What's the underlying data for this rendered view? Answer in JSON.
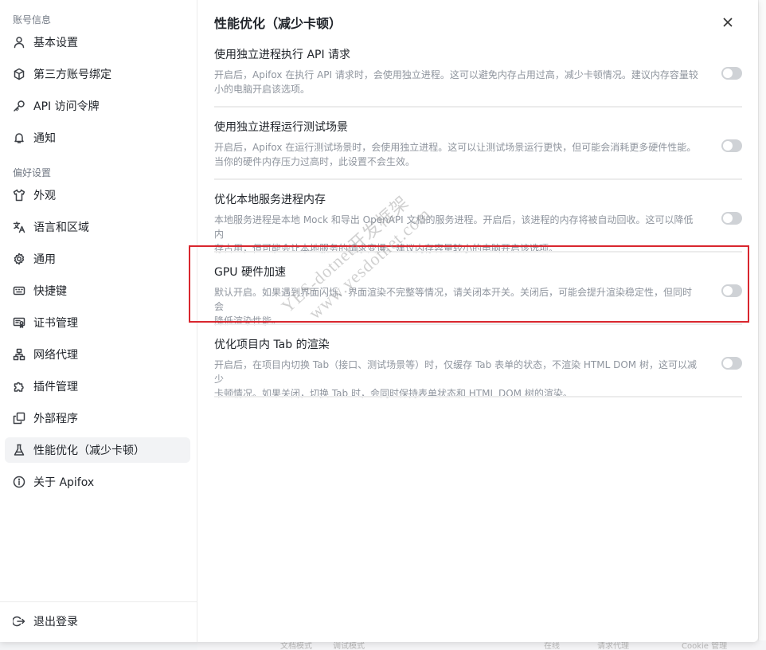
{
  "sidebar": {
    "group1_title": "账号信息",
    "group2_title": "偏好设置",
    "items": [
      {
        "label": "基本设置",
        "icon": "user-icon"
      },
      {
        "label": "第三方账号绑定",
        "icon": "cube-icon"
      },
      {
        "label": "API 访问令牌",
        "icon": "key-icon"
      },
      {
        "label": "通知",
        "icon": "bell-icon"
      },
      {
        "label": "外观",
        "icon": "shirt-icon"
      },
      {
        "label": "语言和区域",
        "icon": "translate-icon"
      },
      {
        "label": "通用",
        "icon": "gear-icon"
      },
      {
        "label": "快捷键",
        "icon": "keyboard-icon"
      },
      {
        "label": "证书管理",
        "icon": "certificate-icon"
      },
      {
        "label": "网络代理",
        "icon": "network-icon"
      },
      {
        "label": "插件管理",
        "icon": "puzzle-icon"
      },
      {
        "label": "外部程序",
        "icon": "external-program-icon"
      },
      {
        "label": "性能优化（减少卡顿）",
        "icon": "flask-icon",
        "active": true
      },
      {
        "label": "关于 Apifox",
        "icon": "info-icon"
      }
    ],
    "logout_label": "退出登录"
  },
  "main": {
    "title": "性能优化（减少卡顿）",
    "settings": [
      {
        "title": "使用独立进程执行 API 请求",
        "desc_lines": [
          "开启后，Apifox 在执行 API 请求时，会使用独立进程。这可以避免内存占用过高，减少卡顿情况。建议内存容量较",
          "小的电脑开启该选项。"
        ],
        "enabled": false
      },
      {
        "title": "使用独立进程运行测试场景",
        "desc_lines": [
          "开启后，Apifox 在运行测试场景时，会使用独立进程。这可以让测试场景运行更快，但可能会消耗更多硬件性能。",
          "当你的硬件内存压力过高时，此设置不会生效。"
        ],
        "enabled": false
      },
      {
        "title": "优化本地服务进程内存",
        "desc_lines": [
          "本地服务进程是本地 Mock 和导出 OpenAPI 文档的服务进程。开启后，该进程的内存将被自动回收。这可以降低内",
          "存占用，但可能会让本地服务的请求变慢。建议内存容量较小的电脑开启该选项。"
        ],
        "enabled": false
      },
      {
        "title": "GPU 硬件加速",
        "desc_lines": [
          "默认开启。如果遇到界面闪烁、界面渲染不完整等情况，请关闭本开关。关闭后，可能会提升渲染稳定性，但同时会",
          "降低渲染性能。"
        ],
        "enabled": false
      },
      {
        "title": "优化项目内 Tab 的渲染",
        "desc_lines": [
          "开启后，在项目内切换 Tab（接口、测试场景等）时，仅缓存 Tab 表单的状态，不渲染 HTML DOM 树，这可以减少",
          "卡顿情况。如果关闭，切换 Tab 时，会同时保持表单状态和 HTML DOM 树的渲染。"
        ],
        "enabled": false
      }
    ]
  },
  "watermark": {
    "line1": "YES-dotnet开发框架",
    "line2": "www.yesdotnet.com"
  },
  "background": {
    "bottom_items": [
      "文档模式",
      "调试模式",
      "在线",
      "请求代理",
      "Cookie 管理"
    ]
  },
  "colors": {
    "highlight_border": "#d9262e",
    "toggle_off": "#cfd2d6",
    "active_bg": "#f2f3f5"
  }
}
